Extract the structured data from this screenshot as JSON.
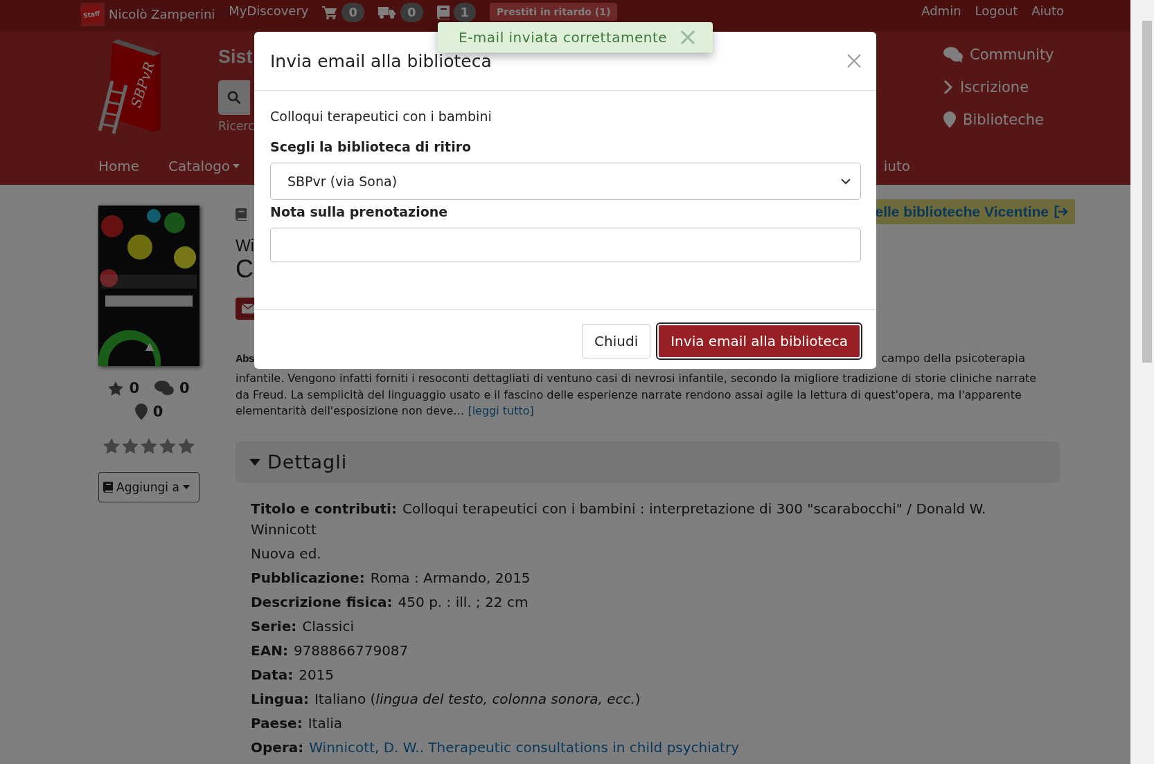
{
  "topbar": {
    "staff_badge": "Staff",
    "user": "Nicolò Zamperini",
    "links_left": [
      "MyDiscovery"
    ],
    "counters": [
      {
        "kind": "cart",
        "count": "0"
      },
      {
        "kind": "truck",
        "count": "0"
      },
      {
        "kind": "book",
        "count": "1"
      }
    ],
    "alert": "Prestiti in ritardo (1)",
    "links_right": [
      "Admin",
      "Logout",
      "Aiuto"
    ]
  },
  "header": {
    "logo_text": "SBPvR",
    "title": "Sist",
    "search_caption": "Ricerc",
    "side_links": [
      {
        "kind": "community",
        "label": "Community"
      },
      {
        "kind": "chevron",
        "label": "Iscrizione"
      },
      {
        "kind": "pin",
        "label": "Biblioteche"
      }
    ],
    "nav": [
      {
        "label": "Home",
        "dropdown": false
      },
      {
        "label": "Catalogo",
        "dropdown": true
      },
      {
        "label": "iuto",
        "dropdown": false
      }
    ]
  },
  "record": {
    "stats": [
      {
        "kind": "star",
        "count": "0"
      },
      {
        "kind": "comments",
        "count": "0"
      },
      {
        "kind": "pin",
        "count": "0"
      }
    ],
    "stars": 0,
    "add_button": "Aggiungi a",
    "title_line_1": "Wi",
    "title_line_2": "C",
    "external_link": "elle biblioteche Vicentine",
    "abstract": {
      "label": "Abs",
      "line_end": "campo della psicoterapia",
      "text": "infantile. Vengono infatti forniti i resoconti dettagliati di ventuno casi di nevrosi infantile, secondo la migliore tradizione di storie cliniche narrate da Freud. La semplicità del linguaggio usato e il fascino delle esperienze narrate rendono assai agile la lettura di quest'opera, ma l'apparente elementarità dell'esposizione non deve…",
      "more": "[leggi tutto]"
    },
    "details": {
      "heading": "Dettagli",
      "expanded": true,
      "rows": [
        {
          "kind": "text",
          "label": "Titolo e contributi:",
          "value": "Colloqui terapeutici con i bambini : interpretazione di 300 \"scarabocchi\" / Donald W. Winnicott"
        },
        {
          "kind": "text",
          "value": "Nuova ed."
        },
        {
          "kind": "text",
          "label": "Pubblicazione:",
          "value": "Roma : Armando, 2015"
        },
        {
          "kind": "text",
          "label": "Descrizione fisica:",
          "value": "450 p. : ill. ; 22 cm"
        },
        {
          "kind": "text",
          "label": "Serie:",
          "value": "Classici"
        },
        {
          "kind": "text",
          "label": "EAN:",
          "value": "9788866779087"
        },
        {
          "kind": "text",
          "label": "Data:",
          "value": "2015"
        },
        {
          "kind": "text",
          "label": "Lingua:",
          "value": "Italiano (*lingua del testo, colonna sonora, ecc.*)"
        },
        {
          "kind": "text",
          "label": "Paese:",
          "value": "Italia"
        },
        {
          "kind": "link",
          "label": "Opera:",
          "value": "Winnicott, D. W.. Therapeutic consultations in child psychiatry"
        }
      ]
    }
  },
  "modal": {
    "title": "Invia email alla biblioteca",
    "subtitle": "Colloqui terapeutici con i bambini",
    "library_label": "Scegli la biblioteca di ritiro",
    "library_value": "SBPvr (via Sona)",
    "note_label": "Nota sulla prenotazione",
    "buttons": [
      {
        "kind": "secondary",
        "label": "Chiudi"
      },
      {
        "kind": "primary",
        "label": "Invia email alla biblioteca"
      }
    ]
  },
  "toast": {
    "message": "E-mail inviata correttamente"
  }
}
